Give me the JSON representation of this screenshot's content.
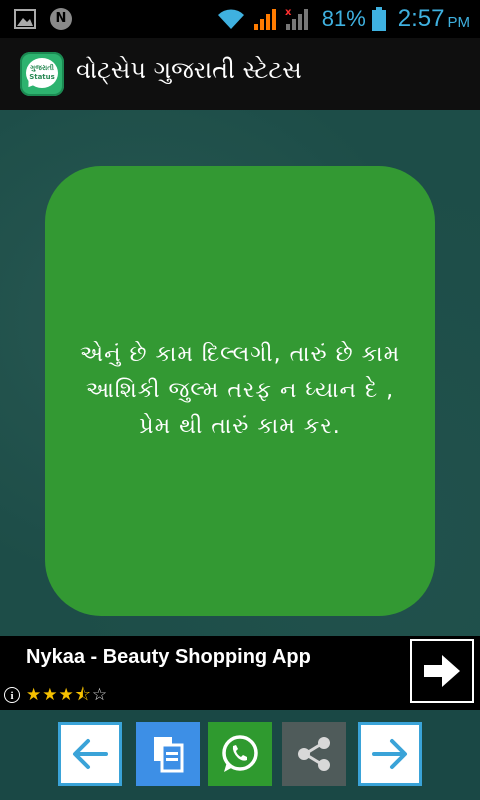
{
  "status_bar": {
    "notification_badge": "N",
    "battery_percent": "81%",
    "time": "2:57",
    "ampm": "PM"
  },
  "app_bar": {
    "icon_line1": "ગુજરાતી",
    "icon_line2": "Status",
    "title": "વોટ્સેપ ગુજરાતી સ્ટેટસ"
  },
  "quote": {
    "text": "એનું છે કામ દિલ્લગી, તારું છે કામ આશિકી જુલ્મ તરફ ન ધ્યાન દે , પ્રેમ થી તારું કામ કર."
  },
  "ad": {
    "title": "Nykaa - Beauty Shopping App",
    "info_label": "i",
    "rating": 3.5,
    "stars_filled": "★★★",
    "stars_half": "⯪",
    "stars_empty": "☆"
  },
  "toolbar": {
    "buttons": [
      "prev-arrow-icon",
      "copy-icon",
      "whatsapp-icon",
      "share-icon",
      "next-arrow-icon"
    ]
  },
  "colors": {
    "card_green": "#339933",
    "status_blue": "#3fb1e0",
    "background": "#1d4d48"
  }
}
